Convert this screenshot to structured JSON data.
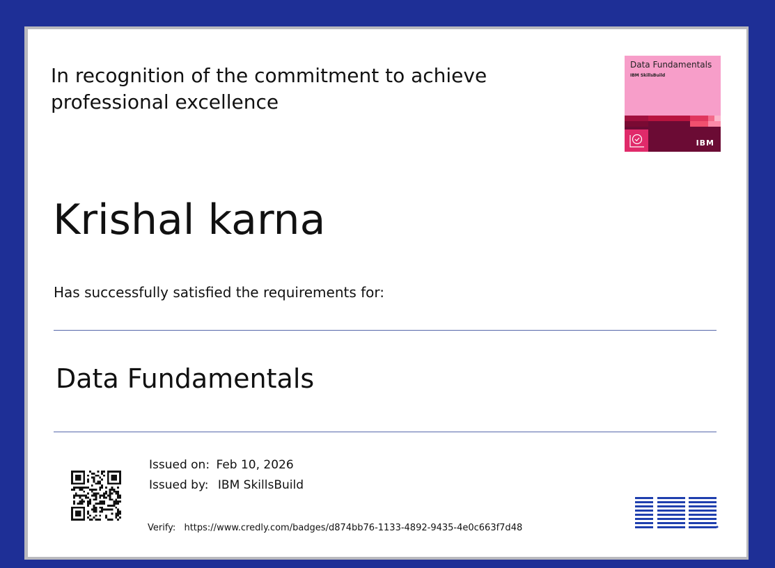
{
  "certificate": {
    "headline": "In recognition of the commitment to achieve professional excellence",
    "recipient": "Krishal karna",
    "requirements_text": "Has successfully satisfied the requirements for:",
    "credential": "Data Fundamentals",
    "issued_on_label": "Issued on:",
    "issued_on_value": "Feb 10, 2026",
    "issued_by_label": "Issued by:",
    "issued_by_value": "IBM SkillsBuild",
    "verify_label": "Verify:",
    "verify_url": "https://www.credly.com/badges/d874bb76-1133-4892-9435-4e0c663f7d48"
  },
  "badge": {
    "title": "Data Fundamentals",
    "subtitle": "IBM SkillsBuild",
    "brand": "IBM"
  },
  "logo": {
    "brand": "IBM"
  },
  "colors": {
    "background": "#1e2f96",
    "badge_pink": "#f79ec9",
    "badge_maroon": "#6b0b34",
    "ibm_blue": "#1f3fae"
  },
  "icons": [
    "qr-code-icon",
    "magnifier-check-icon"
  ]
}
